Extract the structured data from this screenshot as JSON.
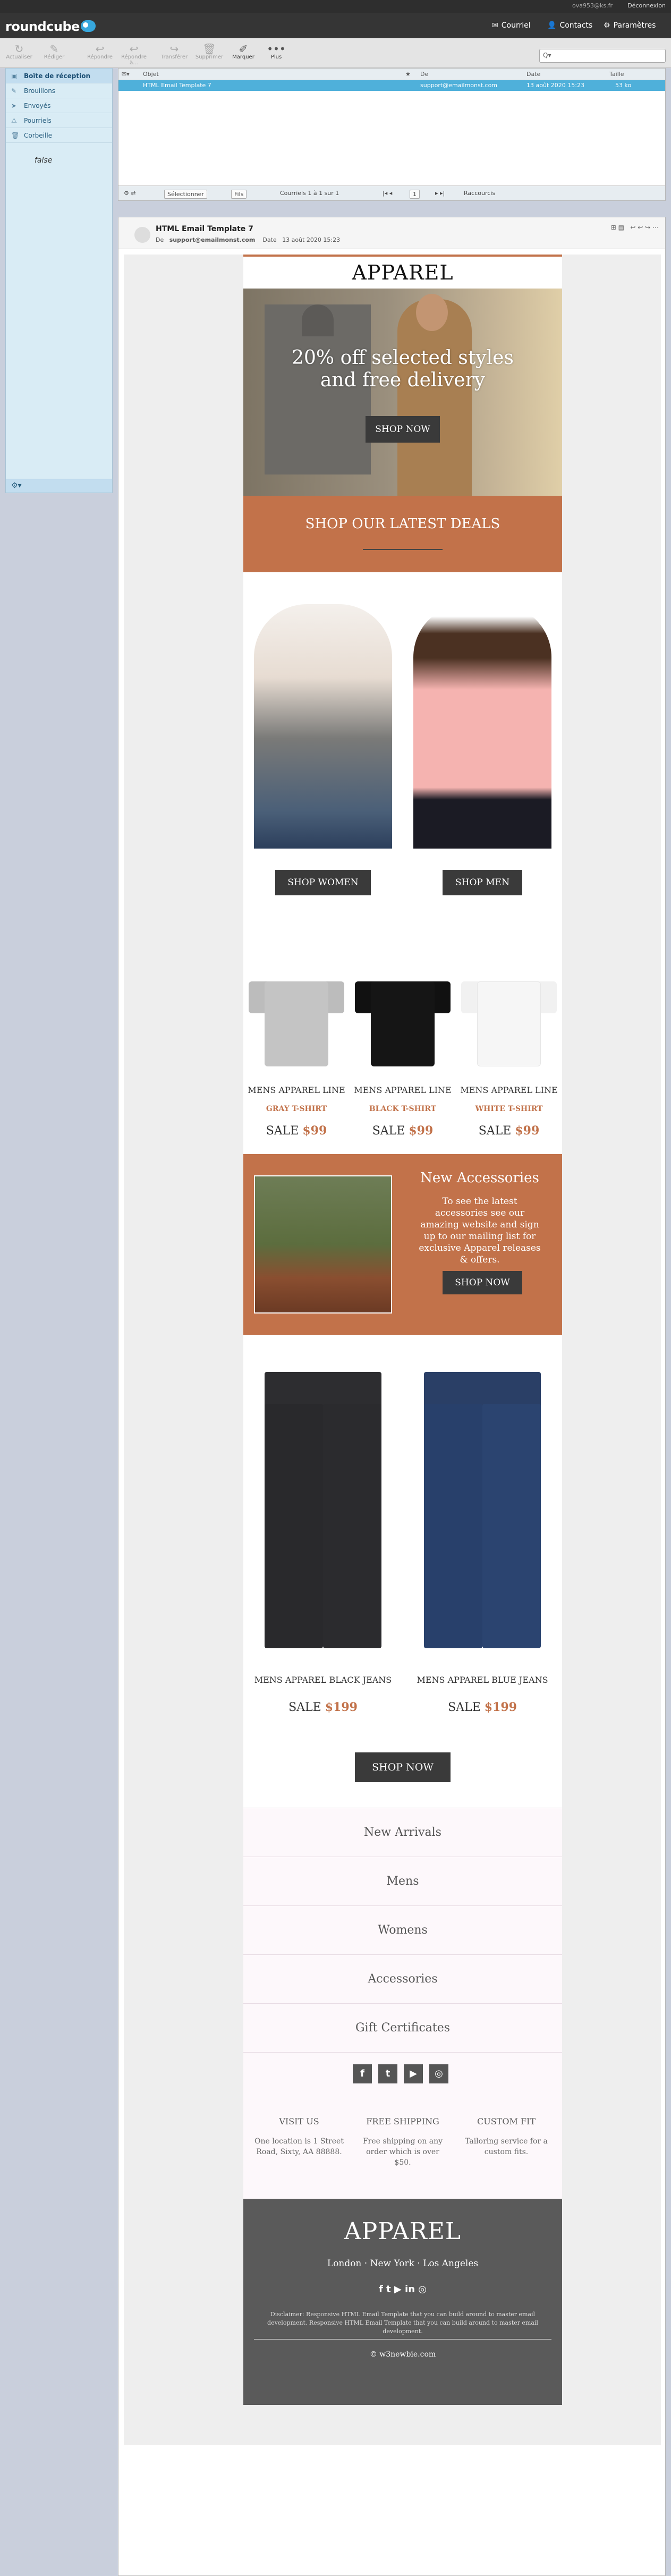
{
  "topbar": {
    "user": "ova953@ks.fr",
    "logout": "Déconnexion"
  },
  "app": {
    "logo": "roundcube"
  },
  "nav": {
    "mail": "Courriel",
    "contacts": "Contacts",
    "settings": "Paramètres"
  },
  "toolbar": {
    "buttons": [
      "Actualiser",
      "Rédiger",
      "Répondre",
      "Répondre à...",
      "Transférer",
      "Supprimer",
      "Marquer",
      "Plus"
    ],
    "search_placeholder": "Q▾"
  },
  "folders": {
    "items": [
      "Boîte de réception",
      "Brouillons",
      "Envoyés",
      "Pourriels",
      "Corbeille"
    ],
    "quota": "false"
  },
  "list": {
    "columns": {
      "subject": "Objet",
      "from": "De",
      "date": "Date",
      "size": "Taille"
    },
    "row": {
      "subject": "HTML Email Template 7",
      "from": "support@emailmonst.com",
      "date": "13 août 2020 15:23",
      "size": "53 ko"
    },
    "select_label": "Sélectionner",
    "thread_label": "Fils",
    "count_text": "Courriels 1 à 1 sur 1",
    "page_value": "1",
    "recent_label": "Raccourcis"
  },
  "preview": {
    "subject": "HTML Email Template 7",
    "from_label": "De",
    "from": "support@emailmonst.com",
    "date_label": "Date",
    "date": "13 août 2020 15:23"
  },
  "email": {
    "brand": "APPAREL",
    "hero_line1": "20% off selected styles",
    "hero_line2": "and free delivery",
    "hero_button": "SHOP NOW",
    "band_title": "SHOP OUR LATEST DEALS",
    "shop_women": "SHOP WOMEN",
    "shop_men": "SHOP MEN",
    "tees": [
      {
        "name": "MENS APPAREL LINE",
        "color": "GRAY T-SHIRT",
        "sale": "SALE",
        "price": "$99"
      },
      {
        "name": "MENS APPAREL LINE",
        "color": "BLACK T-SHIRT",
        "sale": "SALE",
        "price": "$99"
      },
      {
        "name": "MENS APPAREL LINE",
        "color": "WHITE T-SHIRT",
        "sale": "SALE",
        "price": "$99"
      }
    ],
    "accessories_title": "New Accessories",
    "accessories_text": "To see the latest accessories see our amazing website and sign up to our mailing list for exclusive Apparel releases & offers.",
    "accessories_button": "SHOP NOW",
    "jeans": [
      {
        "name": "MENS APPAREL BLACK JEANS",
        "sale": "SALE",
        "price": "$199"
      },
      {
        "name": "MENS APPAREL BLUE JEANS",
        "sale": "SALE",
        "price": "$199"
      }
    ],
    "jeans_button": "SHOP NOW",
    "nav_links": [
      "New Arrivals",
      "Mens",
      "Womens",
      "Accessories",
      "Gift Certificates"
    ],
    "features": [
      {
        "title": "VISIT US",
        "text": "One location is 1 Street Road, Sixty, AA 88888."
      },
      {
        "title": "FREE SHIPPING",
        "text": "Free shipping on any order which is over $50."
      },
      {
        "title": "CUSTOM FIT",
        "text": "Tailoring service for a custom fits."
      }
    ],
    "footer_brand": "APPAREL",
    "footer_cities": "London · New York · Los Angeles",
    "footer_icons": "f  t  ▶  in  ◎",
    "disclaimer": "Disclaimer: Responsive HTML Email Template that you can build around to master email development. Responsive HTML Email Template that you can build around to master email development.",
    "copyright": "© w3newbie.com"
  },
  "colors": {
    "accent": "#c2724a",
    "selected_row": "#4fb0da",
    "dark": "#3a3a3a"
  }
}
